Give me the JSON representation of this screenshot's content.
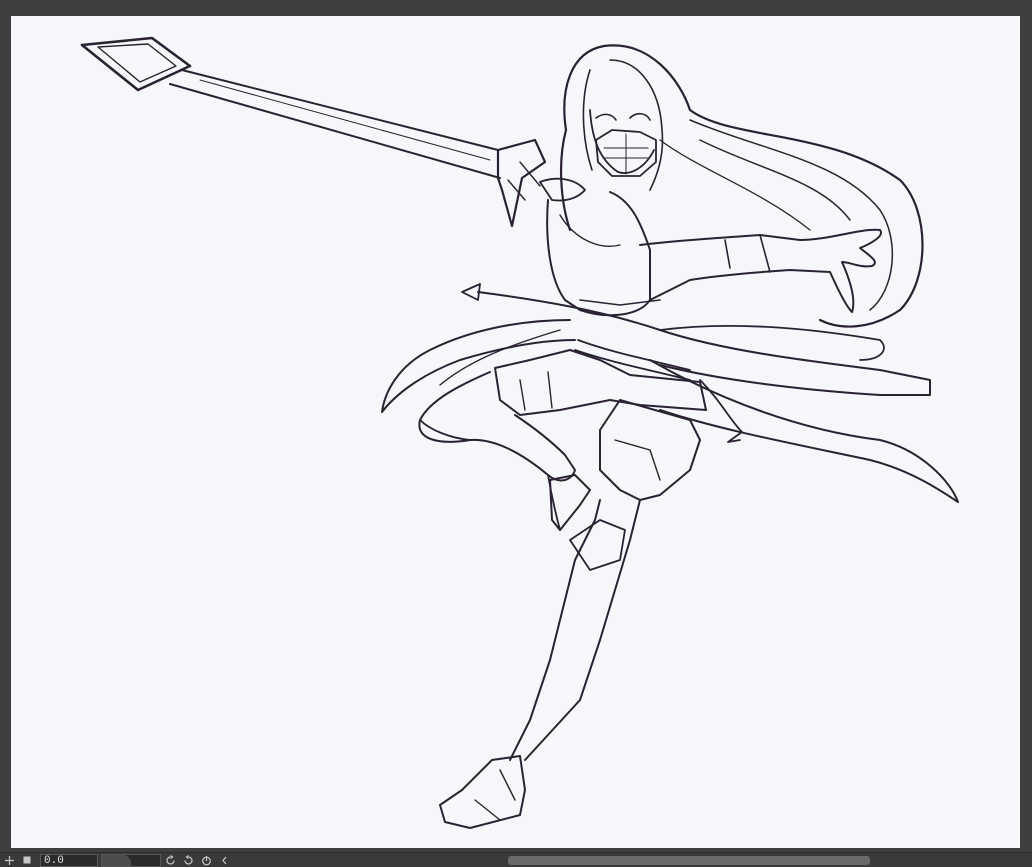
{
  "statusbar": {
    "zoom_value": "0.0",
    "zoom_slider_level": 0.5
  },
  "icons": {
    "add": "plus-icon",
    "stop": "square-icon",
    "rotate_left": "rotate-left-icon",
    "rotate_right": "rotate-right-icon",
    "reset_rotation": "reset-rotation-icon",
    "collapse": "chevron-left-icon"
  },
  "colors": {
    "frame": "#3f3f3f",
    "paper": "#f5f7fb",
    "lineart": "#2a2233"
  }
}
